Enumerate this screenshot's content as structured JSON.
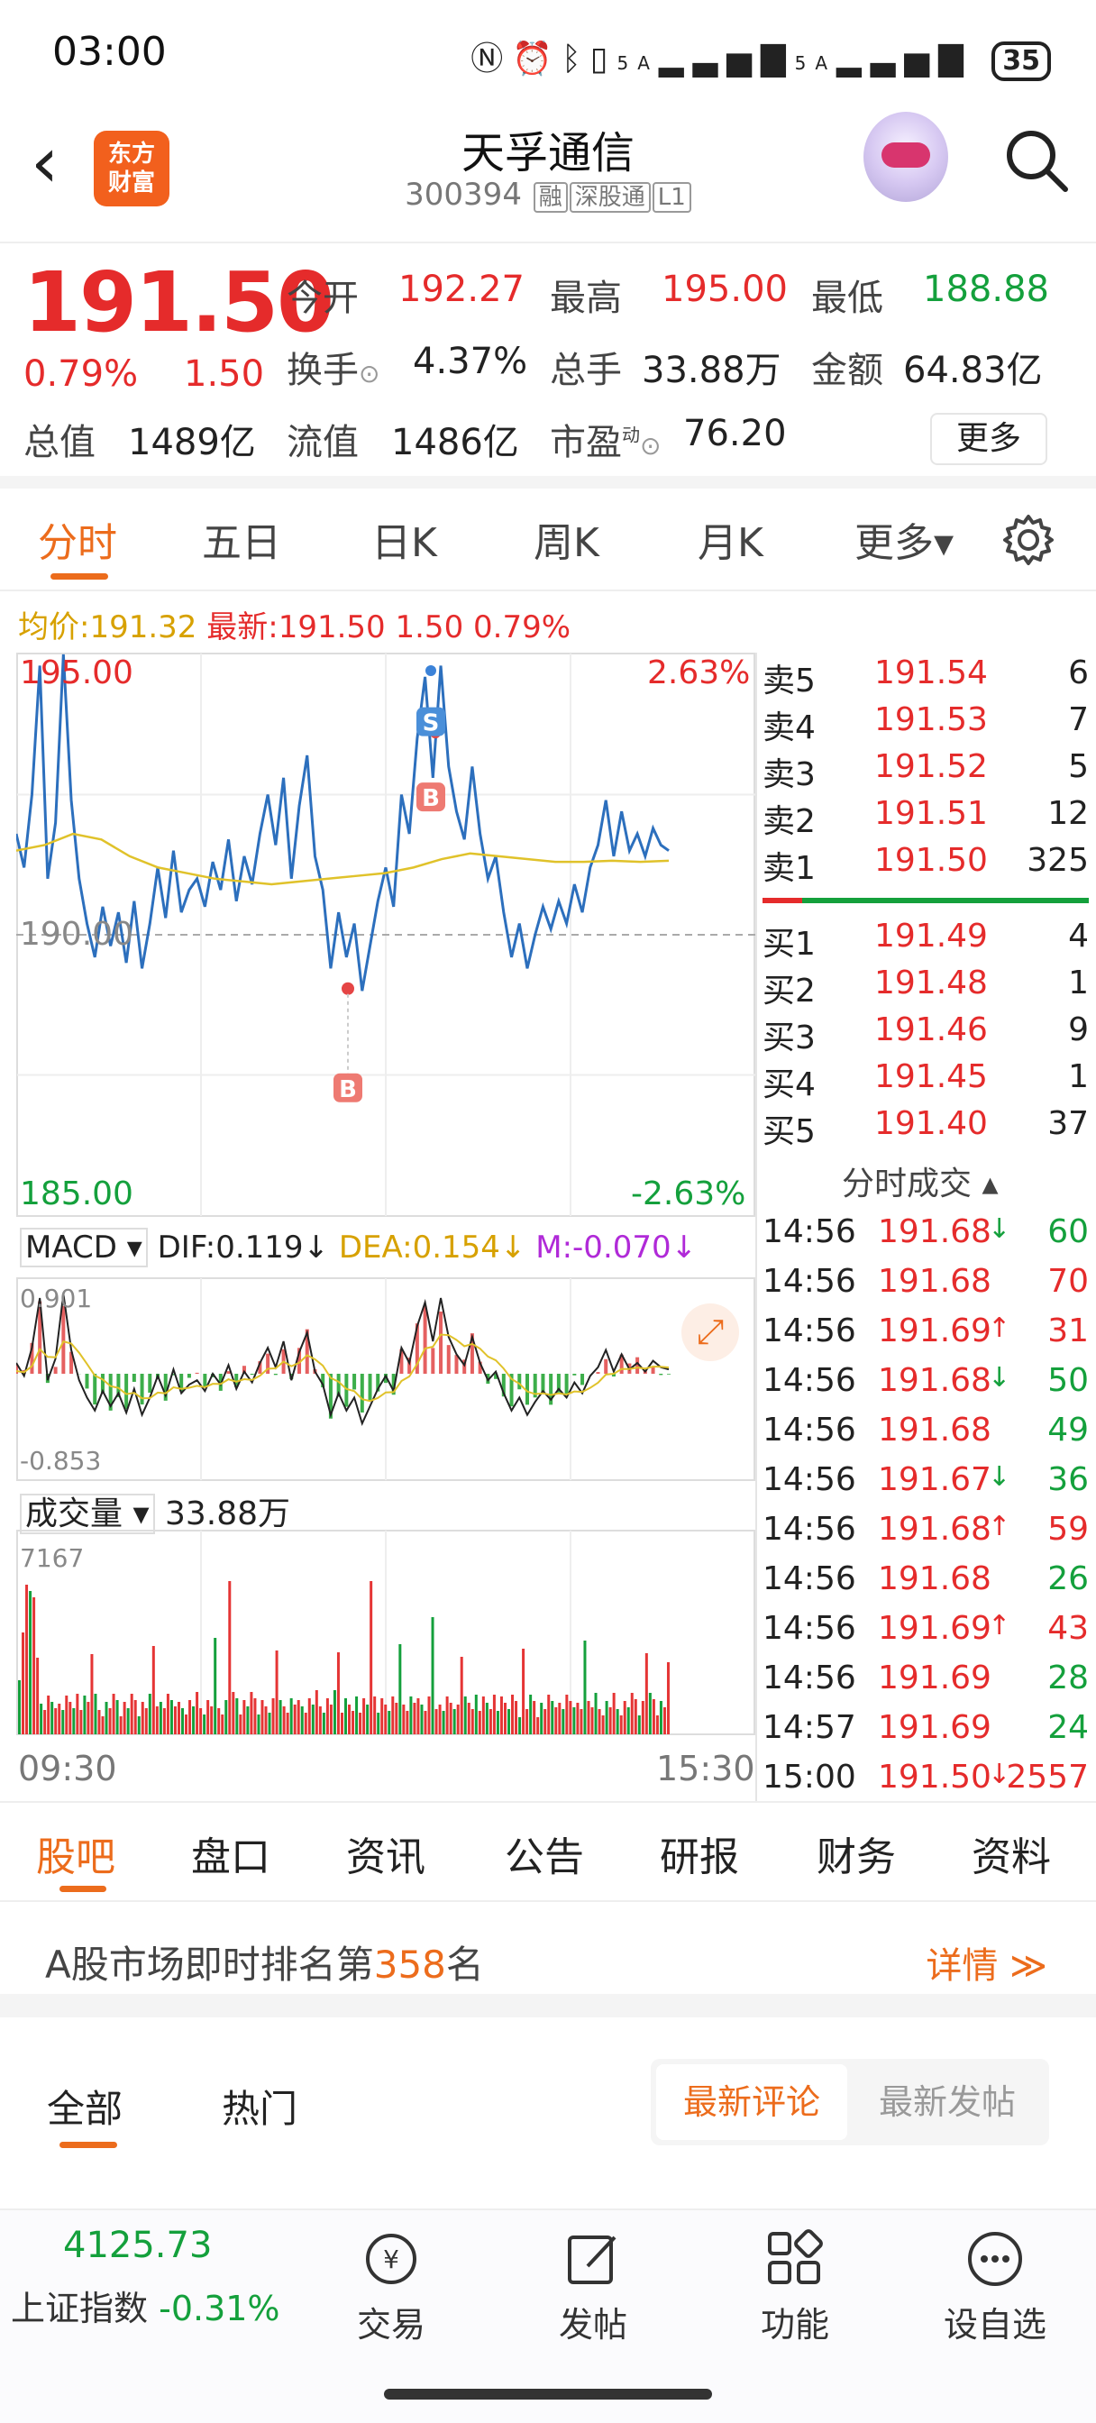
{
  "status": {
    "time": "03:00",
    "battery": "35",
    "signal1": "5A",
    "signal2": "5A"
  },
  "header": {
    "logo_line1": "东方",
    "logo_line2": "财富",
    "title": "天孚通信",
    "code": "300394",
    "tags": [
      "融",
      "深股通",
      "L1"
    ]
  },
  "quote": {
    "price": "191.50",
    "pct": "0.79%",
    "chg": "1.50",
    "open_label": "今开",
    "open": "192.27",
    "high_label": "最高",
    "high": "195.00",
    "low_label": "最低",
    "low": "188.88",
    "turnover_label": "换手",
    "turnover": "4.37%",
    "volume_label": "总手",
    "volume": "33.88万",
    "amount_label": "金额",
    "amount": "64.83亿",
    "mcap_label": "总值",
    "mcap": "1489亿",
    "float_label": "流值",
    "float": "1486亿",
    "pe_label": "市盈",
    "pe_sup": "动",
    "pe": "76.20",
    "more": "更多"
  },
  "tabs": [
    {
      "label": "分时"
    },
    {
      "label": "五日"
    },
    {
      "label": "日K"
    },
    {
      "label": "周K"
    },
    {
      "label": "月K"
    },
    {
      "label": "更多▾"
    }
  ],
  "intraday": {
    "avg_label": "均价:",
    "avg": "191.32",
    "last_label": "最新:",
    "last": "191.50 1.50 0.79%",
    "ymax": "195.00",
    "ymid": "190.00",
    "ymin": "185.00",
    "pmax": "2.63%",
    "pmin": "-2.63%",
    "t_start": "09:30",
    "t_end": "15:30",
    "markers": [
      "S",
      "B",
      "B"
    ]
  },
  "macd": {
    "label": "MACD ▾",
    "dif": "DIF:0.119↓",
    "dea": "DEA:0.154↓",
    "m": "M:-0.070↓",
    "max": "0.901",
    "min": "-0.853"
  },
  "vol": {
    "label": "成交量 ▾",
    "total": "33.88万",
    "max": "7167"
  },
  "chart_data": {
    "type": "line",
    "ylim": [
      185.0,
      195.0
    ],
    "series": [
      {
        "values": [
          191.8,
          191.2,
          192.5,
          194.8,
          191.0,
          192.0,
          195.0,
          192.4,
          191.0,
          190.2,
          189.6,
          190.5,
          189.8,
          190.4,
          189.5,
          190.6,
          189.4,
          190.2,
          191.2,
          190.3,
          191.5,
          190.4,
          190.8,
          191.0,
          190.5,
          191.3,
          190.8,
          191.7,
          190.6,
          191.4,
          190.9,
          191.8,
          192.5,
          191.6,
          192.8,
          191.0,
          192.3,
          193.2,
          191.4,
          190.8,
          189.4,
          190.4,
          189.6,
          190.2,
          189.0,
          189.8,
          190.6,
          191.2,
          190.5,
          192.5,
          191.8,
          193.5,
          194.6,
          192.8,
          194.8,
          193.0,
          192.2,
          191.7,
          193.0,
          191.8,
          191.0,
          191.4,
          190.4,
          189.6,
          190.2,
          189.4,
          190.0,
          190.5,
          190.1,
          190.6,
          190.2,
          190.9,
          190.4,
          191.2,
          191.6,
          192.4,
          191.4,
          192.2,
          191.5,
          191.8,
          191.4,
          191.9,
          191.6,
          191.5
        ]
      },
      {
        "values": [
          191.5,
          191.6,
          191.8,
          191.7,
          191.4,
          191.2,
          191.1,
          191.0,
          190.95,
          190.9,
          190.95,
          191.0,
          191.05,
          191.1,
          191.2,
          191.35,
          191.45,
          191.4,
          191.35,
          191.3,
          191.3,
          191.32,
          191.3,
          191.32
        ]
      }
    ],
    "markers": [
      {
        "type": "S",
        "value": 193.8
      },
      {
        "type": "B",
        "value": 193.1
      },
      {
        "type": "B",
        "value": 189.2
      }
    ]
  },
  "orderbook": {
    "asks": [
      {
        "label": "卖5",
        "price": "191.54",
        "qty": "6"
      },
      {
        "label": "卖4",
        "price": "191.53",
        "qty": "7"
      },
      {
        "label": "卖3",
        "price": "191.52",
        "qty": "5"
      },
      {
        "label": "卖2",
        "price": "191.51",
        "qty": "12"
      },
      {
        "label": "卖1",
        "price": "191.50",
        "qty": "325"
      }
    ],
    "bids": [
      {
        "label": "买1",
        "price": "191.49",
        "qty": "4"
      },
      {
        "label": "买2",
        "price": "191.48",
        "qty": "1"
      },
      {
        "label": "买3",
        "price": "191.46",
        "qty": "9"
      },
      {
        "label": "买4",
        "price": "191.45",
        "qty": "1"
      },
      {
        "label": "买5",
        "price": "191.40",
        "qty": "37"
      }
    ],
    "trades_title": "分时成交 ▴",
    "trades": [
      {
        "time": "14:56",
        "price": "191.68",
        "arrow": "↓",
        "qty": "60",
        "color": "#14a03c"
      },
      {
        "time": "14:56",
        "price": "191.68",
        "arrow": "",
        "qty": "70",
        "color": "#e52b2b"
      },
      {
        "time": "14:56",
        "price": "191.69",
        "arrow": "↑",
        "qty": "31",
        "color": "#e52b2b"
      },
      {
        "time": "14:56",
        "price": "191.68",
        "arrow": "↓",
        "qty": "50",
        "color": "#14a03c"
      },
      {
        "time": "14:56",
        "price": "191.68",
        "arrow": "",
        "qty": "49",
        "color": "#14a03c"
      },
      {
        "time": "14:56",
        "price": "191.67",
        "arrow": "↓",
        "qty": "36",
        "color": "#14a03c"
      },
      {
        "time": "14:56",
        "price": "191.68",
        "arrow": "↑",
        "qty": "59",
        "color": "#e52b2b"
      },
      {
        "time": "14:56",
        "price": "191.68",
        "arrow": "",
        "qty": "26",
        "color": "#14a03c"
      },
      {
        "time": "14:56",
        "price": "191.69",
        "arrow": "↑",
        "qty": "43",
        "color": "#e52b2b"
      },
      {
        "time": "14:56",
        "price": "191.69",
        "arrow": "",
        "qty": "28",
        "color": "#14a03c"
      },
      {
        "time": "14:57",
        "price": "191.69",
        "arrow": "",
        "qty": "24",
        "color": "#14a03c"
      },
      {
        "time": "15:00",
        "price": "191.50",
        "arrow": "↓",
        "qty": "2557",
        "color": "#e52b2b"
      }
    ]
  },
  "bottom_tabs": [
    {
      "label": "股吧"
    },
    {
      "label": "盘口"
    },
    {
      "label": "资讯"
    },
    {
      "label": "公告"
    },
    {
      "label": "研报"
    },
    {
      "label": "财务"
    },
    {
      "label": "资料"
    }
  ],
  "rank": {
    "prefix": "A股市场即时排名第",
    "num": "358",
    "suffix": "名",
    "link": "详情 ≫"
  },
  "filter": {
    "all": "全部",
    "hot": "热门",
    "latest_comment": "最新评论",
    "latest_post": "最新发帖"
  },
  "nav": {
    "index_value": "4125.73",
    "index_name": "上证指数",
    "index_pct": "-0.31%",
    "items": [
      {
        "label": "交易"
      },
      {
        "label": "发帖"
      },
      {
        "label": "功能"
      },
      {
        "label": "设自选"
      }
    ]
  }
}
